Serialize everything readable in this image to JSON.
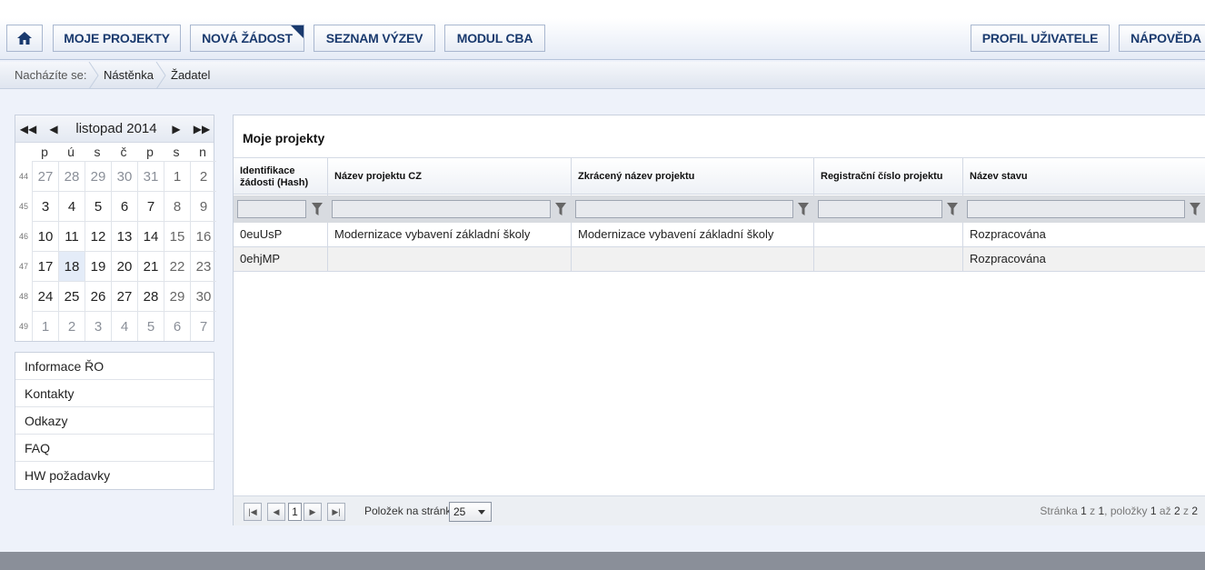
{
  "toolbar": {
    "home_icon": "home-icon",
    "buttons": [
      {
        "label": "MOJE PROJEKTY"
      },
      {
        "label": "NOVÁ ŽÁDOST"
      },
      {
        "label": "SEZNAM VÝZEV"
      },
      {
        "label": "MODUL CBA"
      },
      {
        "label": "PROFIL UŽIVATELE"
      },
      {
        "label": "NÁPOVĚDA"
      }
    ]
  },
  "breadcrumb": {
    "label": "Nacházíte se:",
    "items": [
      "Nástěnka",
      "Žadatel"
    ]
  },
  "calendar": {
    "month": "listopad 2014",
    "weekdays": [
      "p",
      "ú",
      "s",
      "č",
      "p",
      "s",
      "n"
    ],
    "weeks": [
      {
        "num": "44",
        "days": [
          "27",
          "28",
          "29",
          "30",
          "31",
          "1",
          "2"
        ]
      },
      {
        "num": "45",
        "days": [
          "3",
          "4",
          "5",
          "6",
          "7",
          "8",
          "9"
        ]
      },
      {
        "num": "46",
        "days": [
          "10",
          "11",
          "12",
          "13",
          "14",
          "15",
          "16"
        ]
      },
      {
        "num": "47",
        "days": [
          "17",
          "18",
          "19",
          "20",
          "21",
          "22",
          "23"
        ]
      },
      {
        "num": "48",
        "days": [
          "24",
          "25",
          "26",
          "27",
          "28",
          "29",
          "30"
        ]
      },
      {
        "num": "49",
        "days": [
          "1",
          "2",
          "3",
          "4",
          "5",
          "6",
          "7"
        ]
      }
    ],
    "today": "18"
  },
  "sidemenu": {
    "items": [
      "Informace ŘO",
      "Kontakty",
      "Odkazy",
      "FAQ",
      "HW požadavky"
    ]
  },
  "projects": {
    "title": "Moje projekty",
    "columns": [
      "Identifikace žádosti (Hash)",
      "Název projektu CZ",
      "Zkrácený název projektu",
      "Registrační číslo projektu",
      "Název stavu"
    ],
    "rows": [
      [
        "0euUsP",
        "Modernizace vybavení základní školy",
        "Modernizace vybavení základní školy",
        "",
        "Rozpracována"
      ],
      [
        "0ehjMP",
        "",
        "",
        "",
        "Rozpracována"
      ]
    ]
  },
  "pager": {
    "current_page": "1",
    "per_page_label": "Položek na stránku",
    "per_page_value": "25",
    "info_prefix": "Stránka",
    "page": "1",
    "of1": "z",
    "pages": "1",
    "items_label": ", položky",
    "from": "1",
    "to_label": "až",
    "to": "2",
    "of2": "z",
    "total": "2"
  },
  "colors": {
    "accent": "#1a3a6e",
    "footer": "#8a8f99"
  }
}
